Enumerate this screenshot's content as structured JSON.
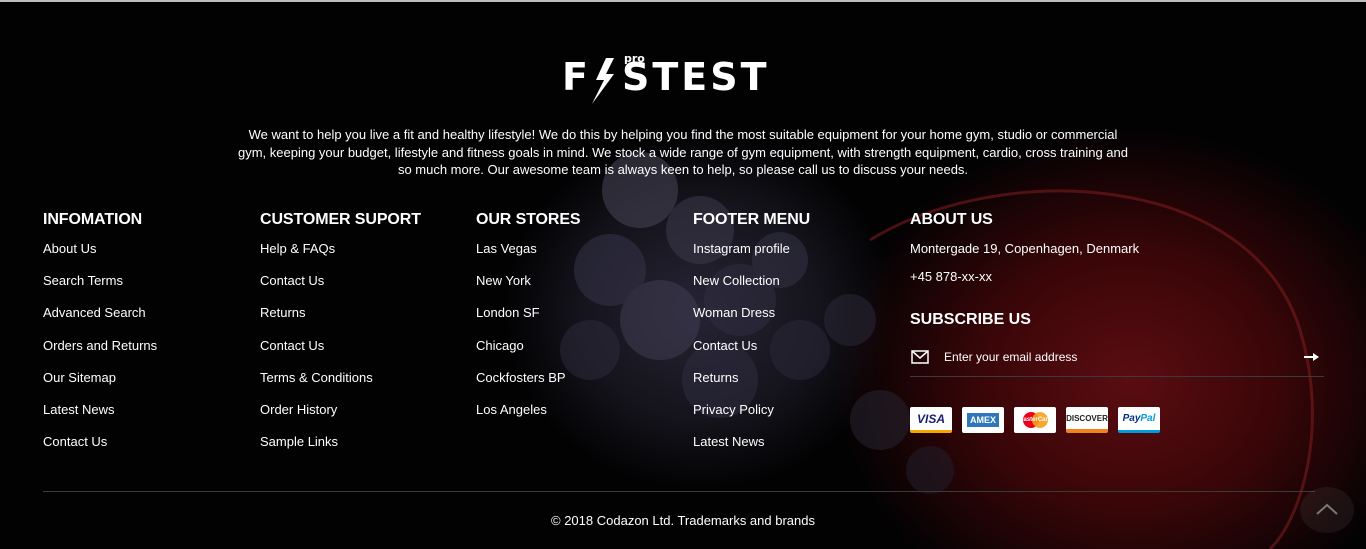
{
  "brand": {
    "logo_text": "FASTEST",
    "logo_sup": "pro"
  },
  "intro": "We want to help you live a fit and healthy lifestyle! We do this by helping you find the most suitable equipment for your home gym, studio or commercial gym, keeping your budget, lifestyle and fitness goals in mind. We stock a wide range of gym equipment, with strength equipment, cardio, cross training and so much more. Our awesome team is always keen to help, so please call us to discuss your needs.",
  "columns": {
    "information": {
      "title": "INFOMATION",
      "items": [
        "About Us",
        "Search Terms",
        "Advanced Search",
        "Orders and Returns",
        "Our Sitemap",
        "Latest News",
        "Contact Us"
      ]
    },
    "customer": {
      "title": "CUSTOMER SUPORT",
      "items": [
        "Help & FAQs",
        "Contact Us",
        "Returns",
        "Contact Us",
        "Terms & Conditions",
        "Order History",
        "Sample Links"
      ]
    },
    "stores": {
      "title": "OUR STORES",
      "items": [
        "Las Vegas",
        "New York",
        "London SF",
        "Chicago",
        "Cockfosters BP",
        "Los Angeles"
      ]
    },
    "menu": {
      "title": "FOOTER MENU",
      "items": [
        "Instagram profile",
        "New Collection",
        "Woman Dress",
        "Contact Us",
        "Returns",
        "Privacy Policy",
        "Latest News"
      ]
    }
  },
  "about": {
    "title": "ABOUT US",
    "address": "Montergade 19, Copenhagen, Denmark",
    "phone": "+45 878-xx-xx"
  },
  "subscribe": {
    "title": "SUBSCRIBE US",
    "placeholder": "Enter your email address"
  },
  "payments": {
    "visa": "VISA",
    "amex": "AMEX",
    "mastercard": "MasterCard",
    "discover": "DISCOVER",
    "paypal_a": "Pay",
    "paypal_b": "Pal"
  },
  "copyright": "© 2018 Codazon Ltd. Trademarks and brands",
  "colors": {
    "background": "#020203",
    "accent_red": "#5a0d12",
    "text": "#ffffff"
  }
}
